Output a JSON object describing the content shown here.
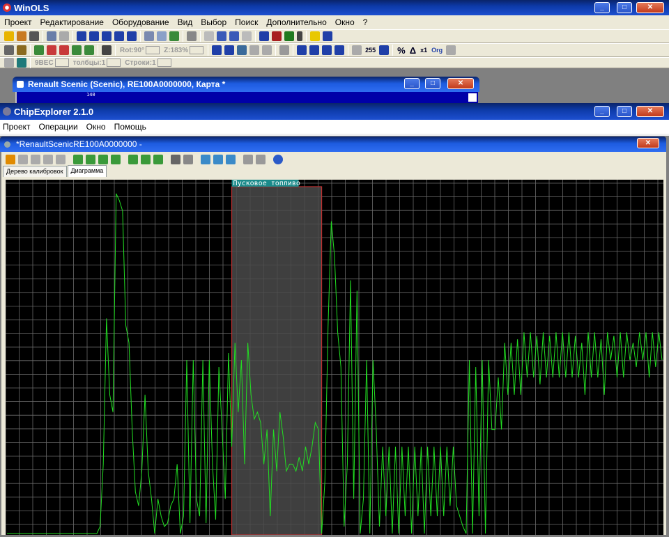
{
  "winols": {
    "title": "WinOLS",
    "menu": [
      "Проект",
      "Редактирование",
      "Оборудование",
      "Вид",
      "Выбор",
      "Поиск",
      "Дополнительно",
      "Окно",
      "?"
    ],
    "toolbar2": {
      "rot": "Rot:90°",
      "zoom": "Z:183%"
    },
    "toolbar2_labels": [
      "255",
      "Org"
    ],
    "toolbar3": {
      "spin1": "9BEC",
      "cols": "толбцы:1",
      "rows": "Строки:1"
    },
    "map_window_title": "Renault Scenic (Scenic), RE100A0000000, Карта *",
    "map_label": "140"
  },
  "chipexplorer": {
    "title": "ChipExplorer 2.1.0",
    "menu": [
      "Проект",
      "Операции",
      "Окно",
      "Помощь"
    ],
    "doc_title": "*RenaultScenicRE100A0000000 -",
    "tabs": [
      "Дерево калибровок",
      "Диаграмма"
    ],
    "active_tab": "Диаграмма"
  },
  "colors": {
    "line": "#22e022",
    "grid": "#6a6a6a",
    "highlight": "#4a4a4a",
    "highlight_border": "#c03030",
    "label_bg": "#1a8a8a"
  },
  "chart_data": {
    "type": "line",
    "highlight_label": "Пусковое топливо",
    "highlight_range": [
      70,
      98
    ],
    "ylim": [
      0,
      100
    ],
    "grid": true,
    "values": [
      0,
      0,
      0,
      0,
      0,
      0,
      0,
      0,
      0,
      0,
      0,
      0,
      0,
      0,
      0,
      0,
      0,
      0,
      0,
      0,
      0,
      0,
      0,
      0,
      0,
      0,
      0,
      0,
      0,
      2,
      20,
      62,
      40,
      35,
      98,
      96,
      93,
      60,
      55,
      30,
      12,
      8,
      18,
      40,
      18,
      10,
      0,
      10,
      5,
      2,
      3,
      8,
      10,
      20,
      0,
      5,
      50,
      3,
      50,
      10,
      5,
      50,
      3,
      50,
      20,
      4,
      48,
      30,
      10,
      52,
      25,
      55,
      35,
      50,
      20,
      55,
      40,
      33,
      35,
      32,
      20,
      30,
      5,
      30,
      18,
      35,
      28,
      18,
      20,
      20,
      18,
      22,
      18,
      25,
      20,
      25,
      32,
      30,
      0,
      15,
      60,
      90,
      80,
      58,
      48,
      2,
      20,
      73,
      10,
      70,
      0,
      10,
      50,
      0,
      50,
      30,
      2,
      25,
      5,
      25,
      0,
      25,
      0,
      25,
      5,
      25,
      0,
      25,
      5,
      25,
      0,
      25,
      5,
      25,
      5,
      25,
      5,
      25,
      8,
      25,
      8,
      5,
      2,
      0,
      50,
      0,
      48,
      5,
      50,
      0,
      50,
      30,
      30,
      45,
      30,
      55,
      40,
      55,
      40,
      56,
      40,
      58,
      45,
      58,
      45,
      57,
      43,
      58,
      45,
      57,
      45,
      58,
      45,
      58,
      45,
      58,
      45,
      57,
      45,
      55,
      40,
      58,
      45,
      58,
      45,
      56,
      40,
      58,
      50,
      57,
      45,
      58,
      45,
      58,
      50,
      55,
      48,
      58,
      50,
      58,
      45,
      58,
      48,
      58,
      50
    ]
  }
}
